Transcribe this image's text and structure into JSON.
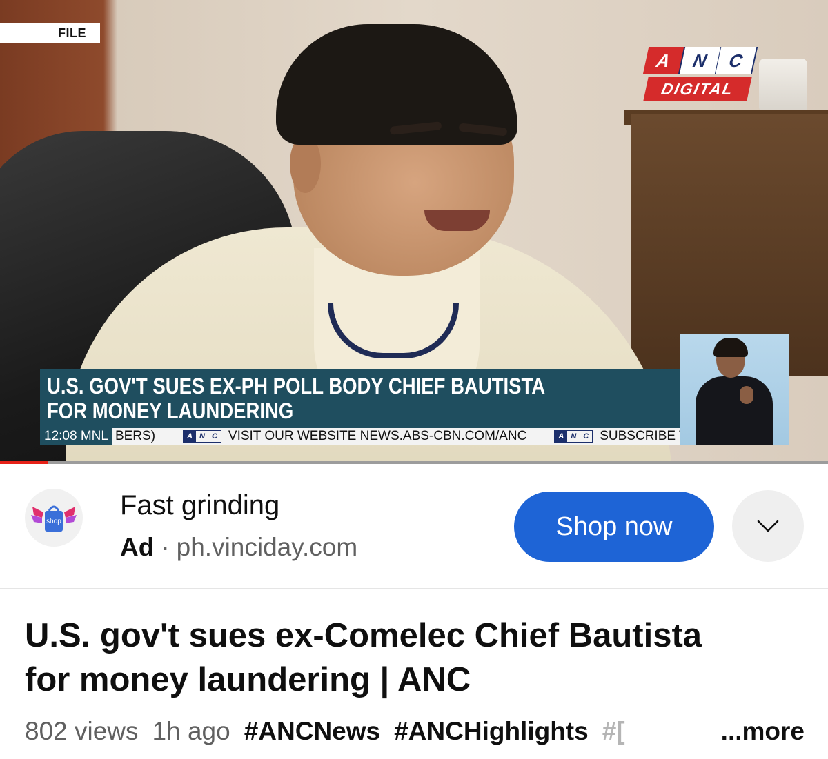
{
  "video": {
    "file_tag": "FILE",
    "channel_logo": {
      "top": [
        "A",
        "N",
        "C"
      ],
      "bottom": "DIGITAL"
    },
    "lower_third": {
      "line1": "U.S. GOV'T SUES EX-PH POLL BODY CHIEF BAUTISTA",
      "line2": "FOR MONEY LAUNDERING"
    },
    "ticker": {
      "time": "12:08 MNL",
      "segment1": "BERS)",
      "segment2": "VISIT OUR WEBSITE NEWS.ABS-CBN.COM/ANC",
      "segment3": "SUBSCRIBE T",
      "logo": [
        "A",
        "N",
        "C"
      ]
    },
    "progress_fraction": 0.058,
    "colors": {
      "progress": "#e62117",
      "lower_third_bg": "#1f4e5f",
      "anc_red": "#d52b2b",
      "anc_blue": "#1c2f6b"
    }
  },
  "ad": {
    "avatar_icon": "shop-logo-icon",
    "avatar_text": "shop",
    "title": "Fast grinding",
    "label": "Ad",
    "separator": "·",
    "domain": "ph.vinciday.com",
    "cta": "Shop now",
    "expand_icon": "chevron-down-icon",
    "colors": {
      "cta_bg": "#1e64d6"
    }
  },
  "title": {
    "line1": "U.S. gov't sues ex-Comelec Chief Bautista",
    "line2": "for money laundering | ANC"
  },
  "meta": {
    "views": "802 views",
    "age": "1h ago",
    "tags": [
      "#ANCNews",
      "#ANCHighlights"
    ],
    "faded_tag": "#[",
    "more": "...more"
  }
}
